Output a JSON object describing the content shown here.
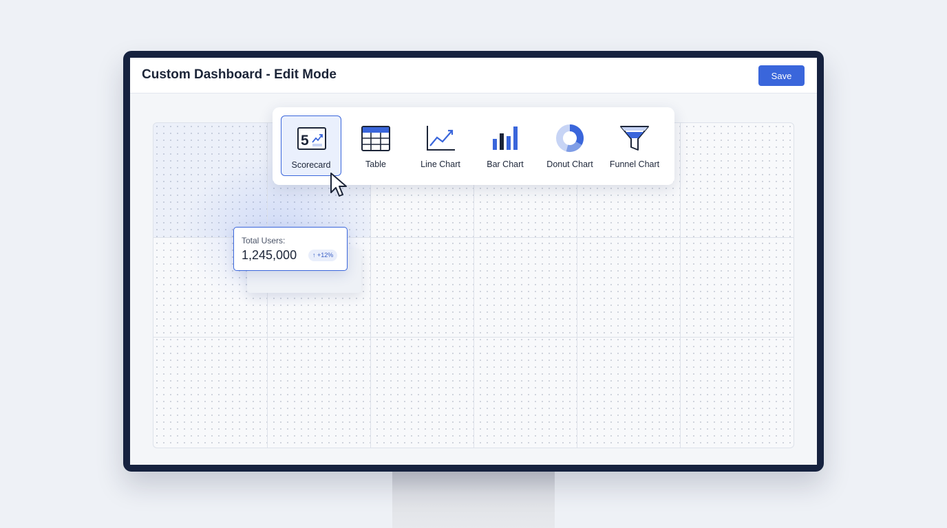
{
  "header": {
    "title": "Custom Dashboard - Edit Mode",
    "save_label": "Save"
  },
  "widget_picker": {
    "items": [
      {
        "label": "Scorecard",
        "icon": "scorecard-icon",
        "icon_text": "5",
        "selected": true
      },
      {
        "label": "Table",
        "icon": "table-icon",
        "selected": false
      },
      {
        "label": "Line Chart",
        "icon": "line-chart-icon",
        "selected": false
      },
      {
        "label": "Bar Chart",
        "icon": "bar-chart-icon",
        "selected": false
      },
      {
        "label": "Donut Chart",
        "icon": "donut-chart-icon",
        "selected": false
      },
      {
        "label": "Funnel Chart",
        "icon": "funnel-chart-icon",
        "selected": false
      }
    ]
  },
  "scorecard_widget": {
    "label": "Total Users:",
    "value": "1,245,000",
    "change": "↑ +12%"
  },
  "colors": {
    "accent": "#3a66db",
    "frame": "#16223f",
    "text": "#1c2538"
  }
}
